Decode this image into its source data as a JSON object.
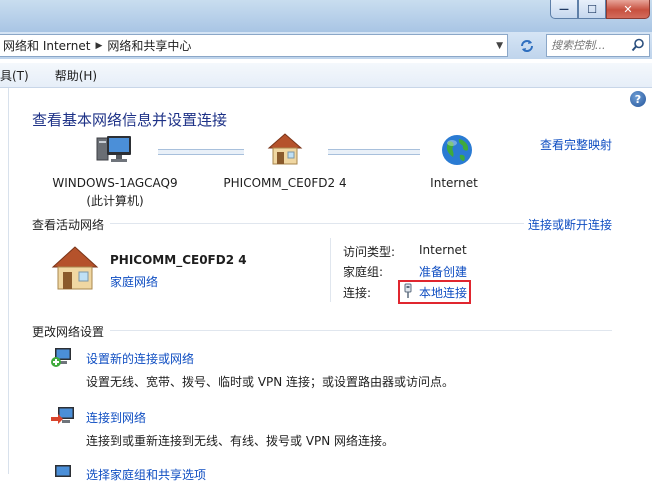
{
  "window": {
    "minimize_glyph": "—",
    "maximize_glyph": "☐",
    "close_glyph": "✕"
  },
  "address": {
    "crumbs": [
      "网络和 Internet",
      "网络和共享中心"
    ],
    "search_placeholder": "搜索控制..."
  },
  "menu": {
    "items": [
      "具(T)",
      "帮助(H)"
    ]
  },
  "help_glyph": "?",
  "page_title": "查看基本网络信息并设置连接",
  "map_link": "查看完整映射",
  "network_map": {
    "computer": {
      "name": "WINDOWS-1AGCAQ9",
      "sub": "(此计算机)"
    },
    "network": {
      "name": "PHICOMM_CE0FD2  4"
    },
    "internet": {
      "name": "Internet"
    }
  },
  "active": {
    "section_label": "查看活动网络",
    "toggle_link": "连接或断开连接",
    "network_name": "PHICOMM_CE0FD2  4",
    "network_type": "家庭网络",
    "fields": {
      "access_type_label": "访问类型:",
      "access_type_value": "Internet",
      "homegroup_label": "家庭组:",
      "homegroup_value": "准备创建",
      "connections_label": "连接:",
      "connections_value": "本地连接"
    }
  },
  "change": {
    "section_label": "更改网络设置",
    "tasks": [
      {
        "title": "设置新的连接或网络",
        "desc": "设置无线、宽带、拨号、临时或 VPN 连接；或设置路由器或访问点。"
      },
      {
        "title": "连接到网络",
        "desc": "连接到或重新连接到无线、有线、拨号或 VPN 网络连接。"
      },
      {
        "title": "选择家庭组和共享选项"
      }
    ]
  },
  "colors": {
    "title_blue": "#1e3287",
    "link_blue": "#0f4ec2",
    "highlight_red": "#e0262f"
  }
}
